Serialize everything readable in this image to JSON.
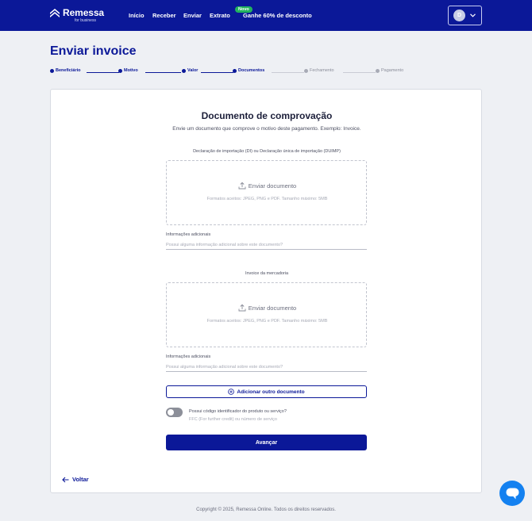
{
  "header": {
    "brand": {
      "name": "Remessa",
      "tagline": "for business"
    },
    "nav": [
      {
        "label": "Início"
      },
      {
        "label": "Receber"
      },
      {
        "label": "Enviar"
      },
      {
        "label": "Extrato"
      },
      {
        "label": "Ganhe 60% de desconto",
        "badge": "Novo"
      }
    ],
    "account": {
      "initial": "D"
    }
  },
  "page": {
    "title": "Enviar invoice"
  },
  "stepper": {
    "steps": [
      {
        "label": "Beneficiário",
        "state": "done"
      },
      {
        "label": "Motivo",
        "state": "done"
      },
      {
        "label": "Valor",
        "state": "done"
      },
      {
        "label": "Documentos",
        "state": "current"
      },
      {
        "label": "Fechamento",
        "state": "pending"
      },
      {
        "label": "Pagamento",
        "state": "pending"
      }
    ]
  },
  "card": {
    "title": "Documento de comprovação",
    "subtitle": "Envie um documento que comprove o motivo deste pagamento. Exemplo: Invoice.",
    "sections": [
      {
        "label": "Declaração de importação (DI) ou Declaração única de importação (DUIMP)",
        "upload_label": "Enviar documento",
        "formats": "Formatos aceitos: JPEG, PNG e PDF. Tamanho máximo: 5MB",
        "info_label": "Informações adicionais",
        "info_placeholder": "Possui alguma informação adicional sobre este documento?",
        "info_value": ""
      },
      {
        "label": "Invoice da mercadoria",
        "upload_label": "Enviar documento",
        "formats": "Formatos aceitos: JPEG, PNG e PDF. Tamanho máximo: 5MB",
        "info_label": "Informações adicionais",
        "info_placeholder": "Possui alguma informação adicional sobre este documento?",
        "info_value": ""
      }
    ],
    "add_document_label": "Adicionar outro documento",
    "toggle": {
      "title": "Possui código identificador do produto ou serviço?",
      "subtitle": "FFC (For further credit) ou número de serviço",
      "on": false
    },
    "primary_button": "Avançar",
    "back_label": "Voltar"
  },
  "footer": {
    "copyright": "Copyright © 2025, Remessa Online. Todos os direitos reservados."
  },
  "colors": {
    "brand": "#0b1898",
    "chat": "#1481f0",
    "badge": "#22b35e"
  }
}
